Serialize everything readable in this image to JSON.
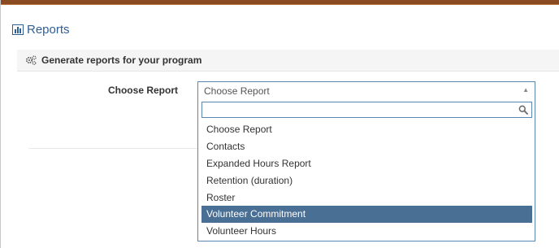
{
  "header": {
    "title": "Reports",
    "icon": "bar-chart-icon"
  },
  "panel": {
    "heading": "Generate reports for your program",
    "icon": "gears-icon"
  },
  "form": {
    "label": "Choose Report",
    "select": {
      "value": "Choose Report",
      "search_placeholder": "",
      "options": [
        "Choose Report",
        "Contacts",
        "Expanded Hours Report",
        "Retention (duration)",
        "Roster",
        "Volunteer Commitment",
        "Volunteer Hours"
      ],
      "highlighted_option": "Volunteer Commitment"
    }
  },
  "colors": {
    "accent_bar": "#8a4b22",
    "title_blue": "#2e5f97",
    "select_border": "#5b86b3",
    "highlight": "#4a6f95"
  }
}
